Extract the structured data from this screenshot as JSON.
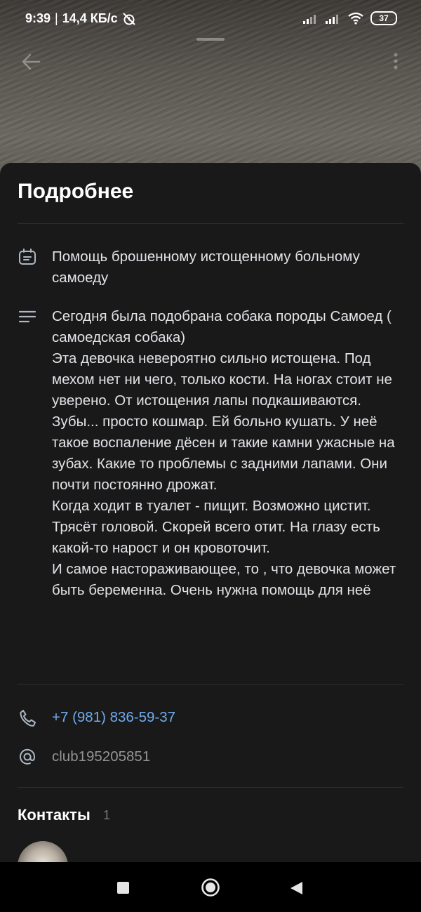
{
  "status_bar": {
    "time": "9:39",
    "separator": "|",
    "speed": "14,4 КБ/с",
    "battery": "37"
  },
  "sheet": {
    "title": "Подробнее",
    "summary": "Помощь брошенному истощенному  больному самоеду",
    "description": "Сегодня была подобрана собака породы Самоед ( самоедская собака)\nЭта девочка невероятно сильно истощена. Под мехом нет ни чего, только кости. На ногах стоит не уверено. От истощения лапы подкашиваются.\nЗубы... просто кошмар. Ей больно кушать. У неё такое воспаление дёсен и такие камни ужасные на зубах. Какие то проблемы с задними лапами. Они почти постоянно дрожат.\nКогда ходит в туалет - пищит. Возможно цистит. Трясёт головой. Скорей всего отит. На глазу есть какой-то нарост и он кровоточит.\nИ самое настораживающее, то , что девочка может быть беременна. Очень нужна помощь для неё",
    "phone": "+7 (981) 836-59-37",
    "club": "club195205851",
    "contacts_label": "Контакты",
    "contacts_count": "1"
  },
  "colors": {
    "link": "#71aaeb",
    "muted": "#939393",
    "sheet_bg": "#19191a",
    "text": "#e1e3e6"
  },
  "icons": {
    "back": "arrow-left-icon",
    "menu": "more-vertical-icon",
    "summary": "event-icon",
    "description": "text-lines-icon",
    "phone": "phone-icon",
    "club": "at-icon"
  }
}
